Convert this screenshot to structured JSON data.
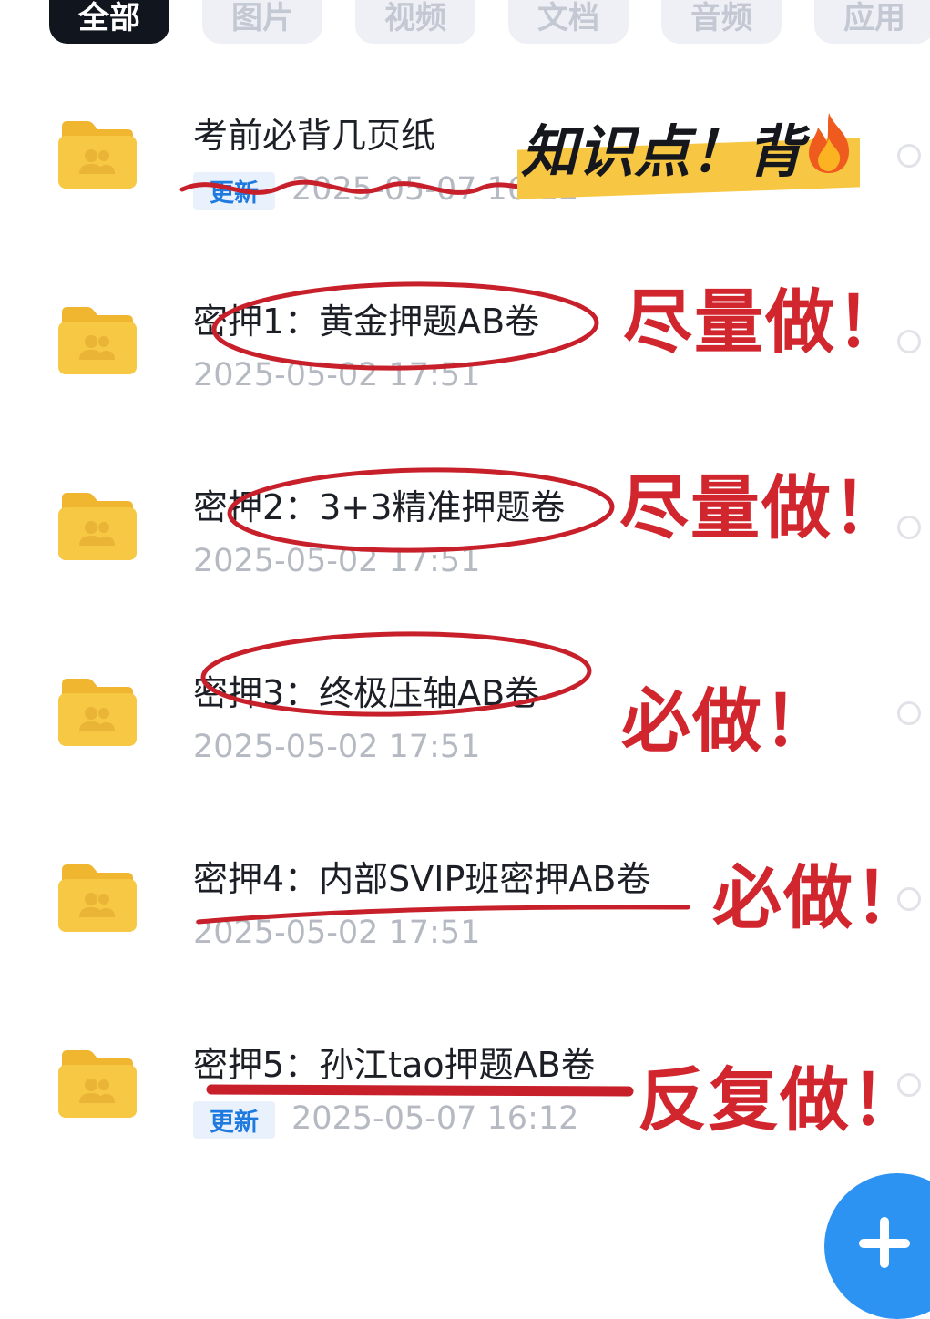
{
  "tabs": [
    {
      "label": "全部",
      "active": true
    },
    {
      "label": "图片",
      "active": false
    },
    {
      "label": "视频",
      "active": false
    },
    {
      "label": "文档",
      "active": false
    },
    {
      "label": "音频",
      "active": false
    },
    {
      "label": "应用",
      "active": false
    }
  ],
  "items": [
    {
      "title": "考前必背几页纸",
      "badge": "更新",
      "time": "2025-05-07 16:12"
    },
    {
      "title": "密押1：黄金押题AB卷",
      "badge": "",
      "time": "2025-05-02 17:51"
    },
    {
      "title": "密押2：3+3精准押题卷",
      "badge": "",
      "time": "2025-05-02 17:51"
    },
    {
      "title": "密押3：终极压轴AB卷",
      "badge": "",
      "time": "2025-05-02 17:51"
    },
    {
      "title": "密押4：内部SVIP班密押AB卷",
      "badge": "",
      "time": "2025-05-02 17:51"
    },
    {
      "title": "密押5：孙江tao押题AB卷",
      "badge": "更新",
      "time": "2025-05-07 16:12"
    }
  ],
  "annotations": {
    "highlight": "知识点！背",
    "note1": "尽量做！",
    "note2": "尽量做！",
    "note3": "必做！",
    "note4": "必做！",
    "note5": "反复做！"
  },
  "icons": {
    "folder": "shared-folder-icon",
    "select": "radio-circle-icon",
    "fire": "fire-emoji-icon",
    "fab": "plus-icon"
  },
  "colors": {
    "folder": "#f7c844",
    "tab_active_bg": "#10151e",
    "tab_bg": "#eef0f5",
    "annotation_red": "#d2262f",
    "marker_yellow": "#f7c743",
    "update_badge_text": "#1f7ae0",
    "fab_blue": "#2c93f2"
  }
}
